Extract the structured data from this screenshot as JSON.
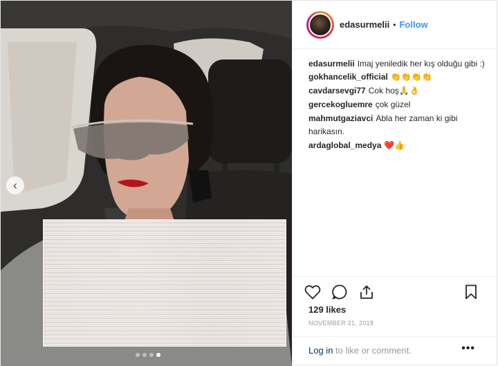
{
  "post": {
    "username": "edasurmelii",
    "separator": "•",
    "follow_label": "Follow",
    "caption_user": "edasurmelii",
    "caption_text": "Imaj yeniledik her kış olduğu gibi :)",
    "comments": [
      {
        "user": "gokhancelik_official",
        "text": "👏👏👏👏"
      },
      {
        "user": "cavdarsevgi77",
        "text": "Cok hoş🙏👌"
      },
      {
        "user": "gercekogluemre",
        "text": "çok güzel"
      },
      {
        "user": "mahmutgaziavci",
        "text": "Abla her zaman ki gibi harikasın."
      },
      {
        "user": "ardaglobal_medya",
        "text": "❤️👍"
      }
    ],
    "likes": "129 likes",
    "date": "NOVEMBER 21, 2018",
    "login_link": "Log in",
    "login_rest": " to like or comment.",
    "more_label": "•••",
    "carousel": {
      "count": 4,
      "active_index": 3
    }
  },
  "icons": {
    "like": "heart-icon",
    "comment": "comment-icon",
    "share": "share-icon",
    "save": "bookmark-icon",
    "prev": "chevron-left-icon"
  },
  "colors": {
    "accent": "#3897f0",
    "link_dark": "#003569",
    "muted": "#999999",
    "text": "#262626"
  }
}
